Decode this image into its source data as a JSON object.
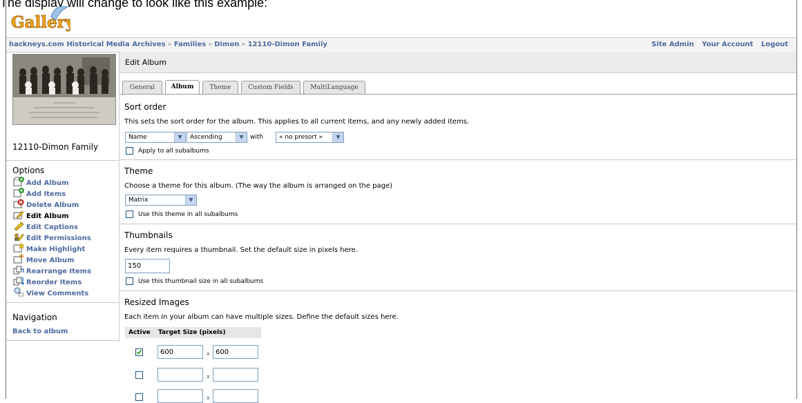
{
  "caption": "The display will change to look like this example:",
  "logo_text": "Gallery",
  "breadcrumb": [
    "hackneys.com Historical Media Archives",
    "Families",
    "Dimon",
    "12110-Dimon Family"
  ],
  "breadcrumb_sep": "»",
  "top_links": [
    "Site Admin",
    "Your Account",
    "Logout"
  ],
  "sidebar": {
    "album_name": "12110-Dimon Family",
    "options_heading": "Options",
    "options": [
      {
        "label": "Add Album",
        "icon": "add-album-icon"
      },
      {
        "label": "Add Items",
        "icon": "add-items-icon"
      },
      {
        "label": "Delete Album",
        "icon": "delete-album-icon"
      },
      {
        "label": "Edit Album",
        "icon": "edit-album-icon"
      },
      {
        "label": "Edit Captions",
        "icon": "edit-captions-icon"
      },
      {
        "label": "Edit Permissions",
        "icon": "edit-permissions-icon"
      },
      {
        "label": "Make Highlight",
        "icon": "make-highlight-icon"
      },
      {
        "label": "Move Album",
        "icon": "move-album-icon"
      },
      {
        "label": "Rearrange Items",
        "icon": "rearrange-items-icon"
      },
      {
        "label": "Reorder Items",
        "icon": "reorder-items-icon"
      },
      {
        "label": "View Comments",
        "icon": "view-comments-icon"
      }
    ],
    "navigation_heading": "Navigation",
    "back_link": "Back to album"
  },
  "main": {
    "title": "Edit Album",
    "tabs": [
      "General",
      "Album",
      "Theme",
      "Custom Fields",
      "MultiLanguage"
    ],
    "active_tab": "Album",
    "sort": {
      "title": "Sort order",
      "desc": "This sets the sort order for the album. This applies to all current items, and any newly added items.",
      "order_by": "Name",
      "direction": "Ascending",
      "with_label": "with",
      "presort": "« no presort »",
      "apply_label": "Apply to all subalbums"
    },
    "theme": {
      "title": "Theme",
      "desc": "Choose a theme for this album. (The way the album is arranged on the page)",
      "value": "Matrix",
      "apply_label": "Use this theme in all subalbums"
    },
    "thumbnails": {
      "title": "Thumbnails",
      "desc": "Every item requires a thumbnail. Set the default size in pixels here.",
      "value": "150",
      "apply_label": "Use this thumbnail size in all subalbums"
    },
    "resized": {
      "title": "Resized Images",
      "desc": "Each item in your album can have multiple sizes. Define the default sizes here.",
      "col_active": "Active",
      "col_target": "Target Size (pixels)",
      "times": "x",
      "rows": [
        {
          "active": true,
          "w": "600",
          "h": "600"
        },
        {
          "active": false,
          "w": "",
          "h": ""
        },
        {
          "active": false,
          "w": "",
          "h": ""
        }
      ]
    }
  }
}
